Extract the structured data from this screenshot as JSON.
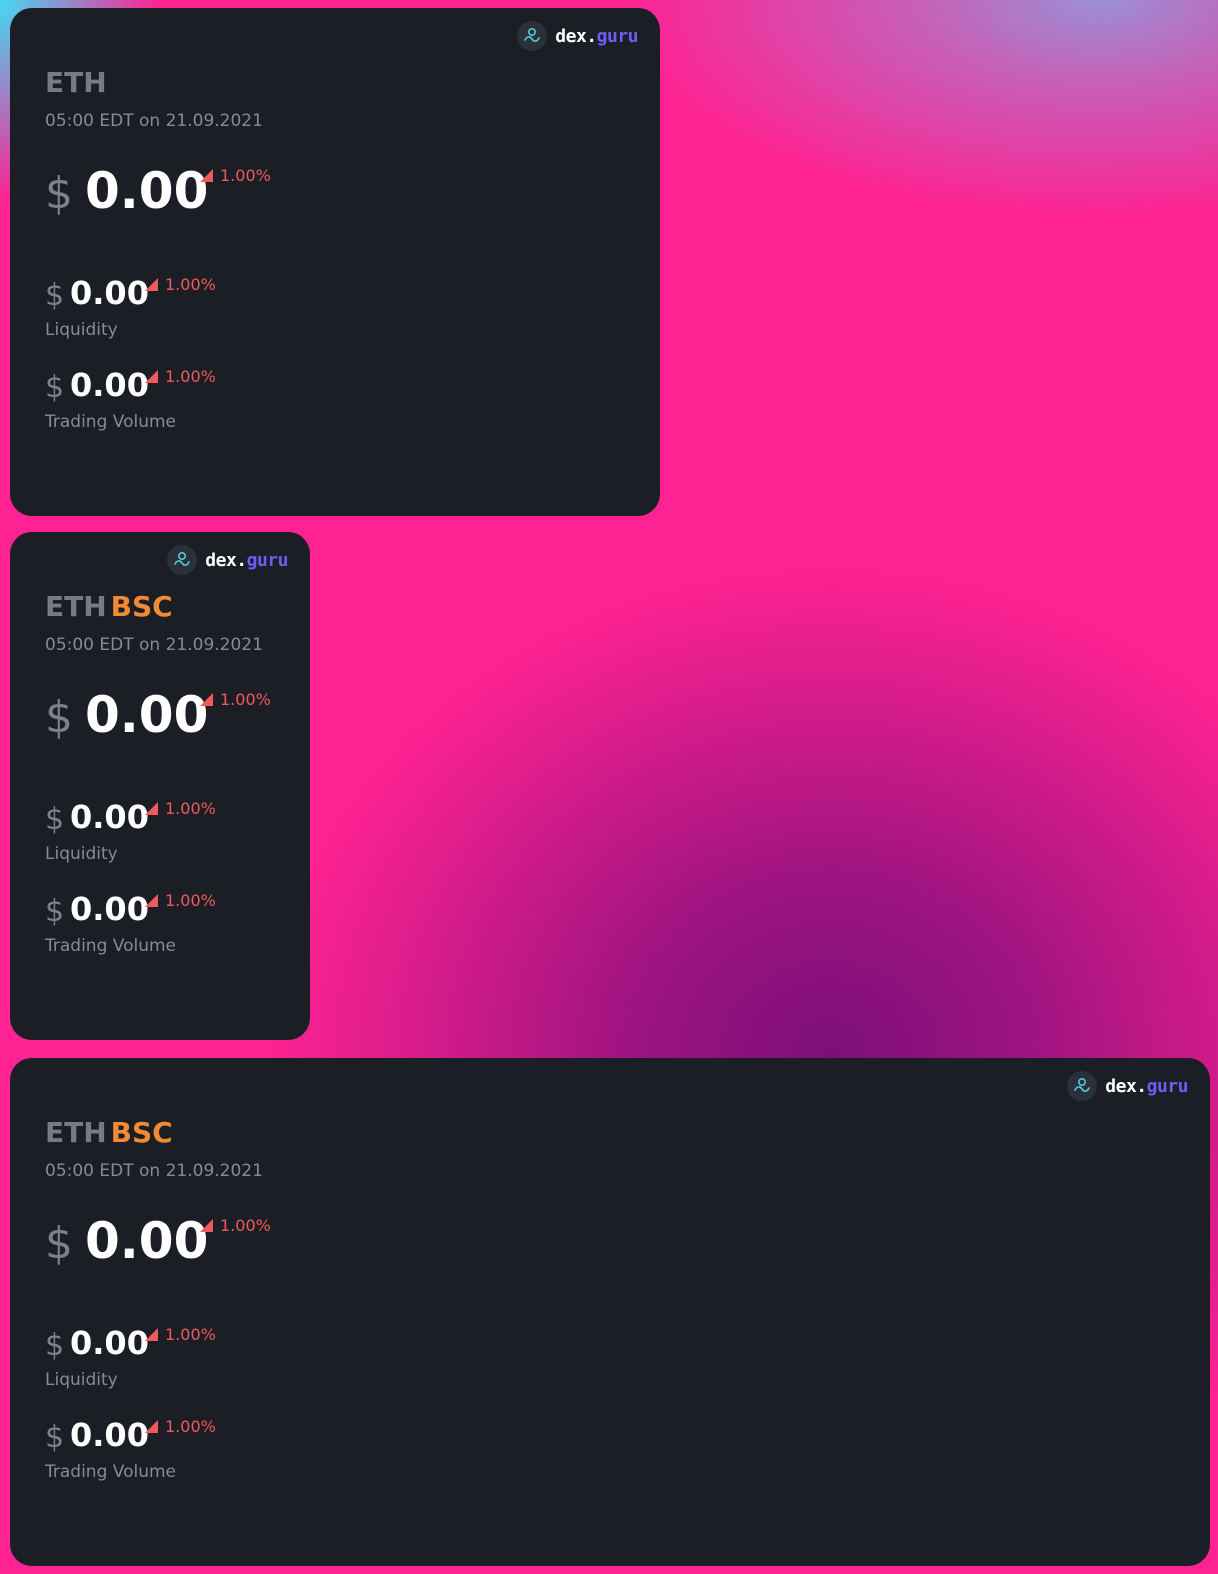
{
  "brand": {
    "name_main": "dex.",
    "name_accent": "guru",
    "icon": "dexguru-logo-icon"
  },
  "colors": {
    "card_bg": "#1b1e24",
    "pair_gray": "#747c86",
    "network_orange": "#f28a35",
    "change_red": "#ef5a5a",
    "brand_purple": "#6f5cf6",
    "background_pink": "#fe2292"
  },
  "cards": [
    {
      "token": "ETH",
      "network": "",
      "timestamp": "05:00 EDT on 21.09.2021",
      "price": {
        "currency": "$",
        "value": "0.00",
        "change": "1.00%"
      },
      "liquidity": {
        "currency": "$",
        "value": "0.00",
        "change": "1.00%",
        "label": "Liquidity"
      },
      "volume": {
        "currency": "$",
        "value": "0.00",
        "change": "1.00%",
        "label": "Trading Volume"
      }
    },
    {
      "token": "ETH",
      "network": "BSC",
      "timestamp": "05:00 EDT on 21.09.2021",
      "price": {
        "currency": "$",
        "value": "0.00",
        "change": "1.00%"
      },
      "liquidity": {
        "currency": "$",
        "value": "0.00",
        "change": "1.00%",
        "label": "Liquidity"
      },
      "volume": {
        "currency": "$",
        "value": "0.00",
        "change": "1.00%",
        "label": "Trading Volume"
      }
    },
    {
      "token": "ETH",
      "network": "BSC",
      "timestamp": "05:00 EDT on 21.09.2021",
      "price": {
        "currency": "$",
        "value": "0.00",
        "change": "1.00%"
      },
      "liquidity": {
        "currency": "$",
        "value": "0.00",
        "change": "1.00%",
        "label": "Liquidity"
      },
      "volume": {
        "currency": "$",
        "value": "0.00",
        "change": "1.00%",
        "label": "Trading Volume"
      }
    }
  ]
}
